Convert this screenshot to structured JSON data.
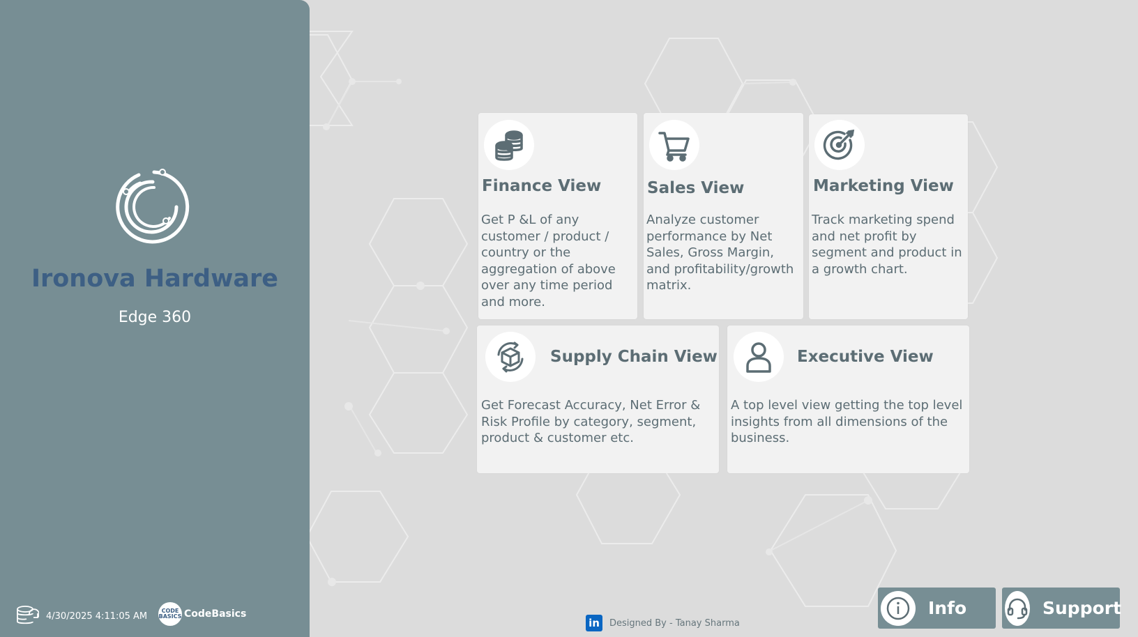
{
  "brand": {
    "title": "Ironova Hardware",
    "subtitle": "Edge 360"
  },
  "footer_left": {
    "refresh_time": "4/30/2025 4:11:05 AM",
    "codebasics_label": "CodeBasics",
    "codebasics_logo_text": "CODE BASICS"
  },
  "cards": [
    {
      "title": "Finance View",
      "description": "Get P &L of any customer / product / country or the aggregation of above over any time period and more.",
      "icon": "coins-icon"
    },
    {
      "title": "Sales View",
      "description": "Analyze customer performance by Net Sales, Gross Margin, and profitability/growth matrix.",
      "icon": "cart-icon"
    },
    {
      "title": "Marketing View",
      "description": "Track marketing spend and net profit by segment and product in a growth chart.",
      "icon": "target-icon"
    },
    {
      "title": "Supply Chain View",
      "description": "Get Forecast Accuracy, Net Error & Risk Profile by category, segment, product & customer etc.",
      "icon": "supply-box-icon"
    },
    {
      "title": "Executive View",
      "description": "A top level view getting the top level insights from all dimensions of the business.",
      "icon": "person-icon"
    }
  ],
  "footer": {
    "designer": "Designed By - Tanay Sharma",
    "linkedin_glyph": "in"
  },
  "buttons": {
    "info": "Info",
    "support": "Support"
  },
  "colors": {
    "panel": "#778e94",
    "brand_title": "#3d5f84",
    "card_bg": "#f2f2f2",
    "card_text": "#5c6d74",
    "background": "#dcdcdc"
  }
}
